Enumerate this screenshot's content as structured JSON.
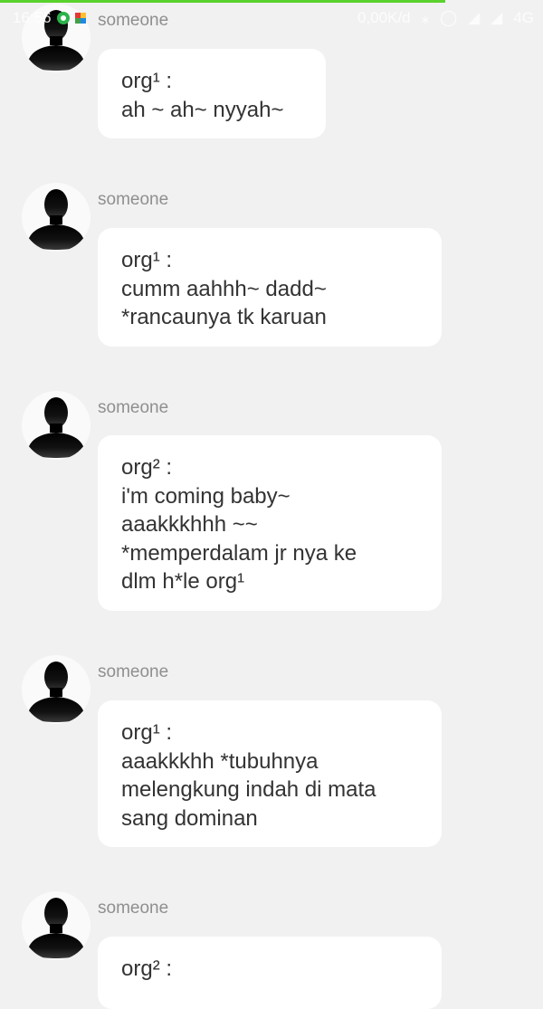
{
  "page_progress": 0.82,
  "status_bar": {
    "time": "16:56",
    "network_speed": "0,00K/d",
    "network_type": "4G",
    "notification_icons": [
      "whatsapp-icon",
      "puzzle-icon"
    ],
    "system_icons": [
      "bluetooth-icon",
      "alarm-icon",
      "signal-icon",
      "signal-icon",
      "signal-icon"
    ]
  },
  "messages": [
    {
      "sender": "someone",
      "lines": [
        "org¹ :",
        "ah ~ ah~ nyyah~"
      ]
    },
    {
      "sender": "someone",
      "lines": [
        "org¹ :",
        "cumm aahhh~ dadd~",
        "*rancaunya tk karuan"
      ]
    },
    {
      "sender": "someone",
      "lines": [
        "org² :",
        "i'm coming baby~",
        "aaakkkhhh ~~",
        "*memperdalam jr nya ke",
        "dlm h*le org¹"
      ]
    },
    {
      "sender": "someone",
      "lines": [
        "org¹ :",
        "aaakkkhh *tubuhnya",
        "melengkung indah di mata",
        "sang dominan"
      ]
    },
    {
      "sender": "someone",
      "lines": [
        "org² :"
      ]
    }
  ]
}
